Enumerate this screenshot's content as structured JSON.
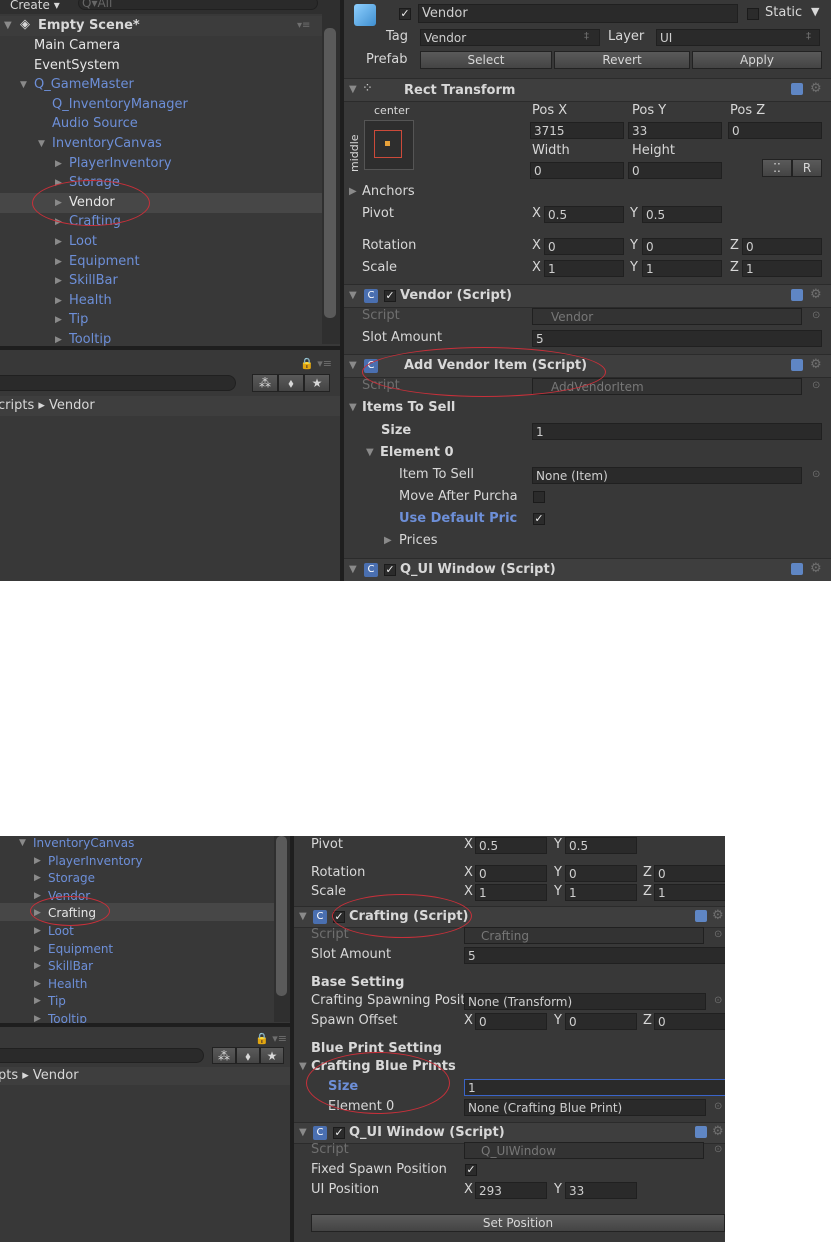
{
  "top": {
    "toolbar": {
      "create_label": "Create ▾",
      "search_placeholder": "Q▾All"
    },
    "scene_title": "Empty Scene*",
    "hierarchy": [
      {
        "label": "Main Camera",
        "blue": false
      },
      {
        "label": "EventSystem",
        "blue": false
      },
      {
        "label": "Q_GameMaster",
        "blue": true
      },
      {
        "label": "Q_InventoryManager",
        "blue": true
      },
      {
        "label": "Audio Source",
        "blue": true
      },
      {
        "label": "InventoryCanvas",
        "blue": true
      },
      {
        "label": "PlayerInventory",
        "blue": true
      },
      {
        "label": "Storage",
        "blue": true
      },
      {
        "label": "Vendor",
        "blue": false
      },
      {
        "label": "Crafting",
        "blue": true
      },
      {
        "label": "Loot",
        "blue": true
      },
      {
        "label": "Equipment",
        "blue": true
      },
      {
        "label": "SkillBar",
        "blue": true
      },
      {
        "label": "Health",
        "blue": true
      },
      {
        "label": "Tip",
        "blue": true
      },
      {
        "label": "Tooltip",
        "blue": true
      }
    ],
    "project_breadcrumb": "cripts ▸ Vendor",
    "inspector": {
      "object_name": "Vendor",
      "static_label": "Static",
      "tag_label": "Tag",
      "tag_value": "Vendor",
      "layer_label": "Layer",
      "layer_value": "UI",
      "prefab_label": "Prefab",
      "prefab_buttons": [
        "Select",
        "Revert",
        "Apply"
      ],
      "rect_transform": {
        "title": "Rect Transform",
        "anchor_preset_h": "center",
        "anchor_preset_v": "middle",
        "pos_x_label": "Pos X",
        "pos_y_label": "Pos Y",
        "pos_z_label": "Pos Z",
        "pos_x": "3715",
        "pos_y": "33",
        "pos_z": "0",
        "width_label": "Width",
        "height_label": "Height",
        "width": "0",
        "height": "0",
        "r_button": "R",
        "anchors_label": "Anchors",
        "pivot_label": "Pivot",
        "pivot_x": "0.5",
        "pivot_y": "0.5",
        "rotation_label": "Rotation",
        "rot_x": "0",
        "rot_y": "0",
        "rot_z": "0",
        "scale_label": "Scale",
        "scale_x": "1",
        "scale_y": "1",
        "scale_z": "1"
      },
      "vendor_script": {
        "title": "Vendor (Script)",
        "script_label": "Script",
        "script_value": "Vendor",
        "slot_amount_label": "Slot Amount",
        "slot_amount": "5"
      },
      "add_vendor_item": {
        "title": "Add Vendor Item (Script)",
        "script_label": "Script",
        "script_value": "AddVendorItem",
        "items_to_sell": "Items To Sell",
        "size_label": "Size",
        "size_value": "1",
        "element0": "Element 0",
        "item_to_sell_label": "Item To Sell",
        "item_to_sell_value": "None (Item)",
        "move_after_label": "Move After Purcha",
        "use_default_label": "Use Default Pric",
        "prices_label": "Prices"
      },
      "ui_window_title": "Q_UI Window (Script)"
    }
  },
  "bottom": {
    "hierarchy": [
      {
        "label": "InventoryCanvas",
        "blue": true
      },
      {
        "label": "PlayerInventory",
        "blue": true
      },
      {
        "label": "Storage",
        "blue": true
      },
      {
        "label": "Vendor",
        "blue": true
      },
      {
        "label": "Crafting",
        "blue": false
      },
      {
        "label": "Loot",
        "blue": true
      },
      {
        "label": "Equipment",
        "blue": true
      },
      {
        "label": "SkillBar",
        "blue": true
      },
      {
        "label": "Health",
        "blue": true
      },
      {
        "label": "Tip",
        "blue": true
      },
      {
        "label": "Tooltip",
        "blue": true
      }
    ],
    "project_breadcrumb": "pts ▸ Vendor",
    "inspector": {
      "pivot_label": "Pivot",
      "pivot_x": "0.5",
      "pivot_y": "0.5",
      "rotation_label": "Rotation",
      "rot_x": "0",
      "rot_y": "0",
      "rot_z": "0",
      "scale_label": "Scale",
      "scale_x": "1",
      "scale_y": "1",
      "scale_z": "1",
      "crafting": {
        "title": "Crafting (Script)",
        "script_label": "Script",
        "script_value": "Crafting",
        "slot_amount_label": "Slot Amount",
        "slot_amount": "5",
        "base_setting": "Base Setting",
        "spawn_pos_label": "Crafting Spawning Posit",
        "spawn_pos_value": "None (Transform)",
        "spawn_offset_label": "Spawn Offset",
        "off_x": "0",
        "off_y": "0",
        "off_z": "0",
        "blueprint_setting": "Blue Print Setting",
        "crafting_blueprints": "Crafting Blue Prints",
        "size_label": "Size",
        "size_value": "1",
        "element0_label": "Element 0",
        "element0_value": "None (Crafting Blue Print)"
      },
      "ui_window": {
        "title": "Q_UI Window (Script)",
        "script_label": "Script",
        "script_value": "Q_UIWindow",
        "fixed_spawn_label": "Fixed Spawn Position",
        "ui_position_label": "UI Position",
        "ui_x": "293",
        "ui_y": "33",
        "set_position_button": "Set Position"
      }
    }
  },
  "axis_letters": {
    "x": "X",
    "y": "Y",
    "z": "Z"
  }
}
